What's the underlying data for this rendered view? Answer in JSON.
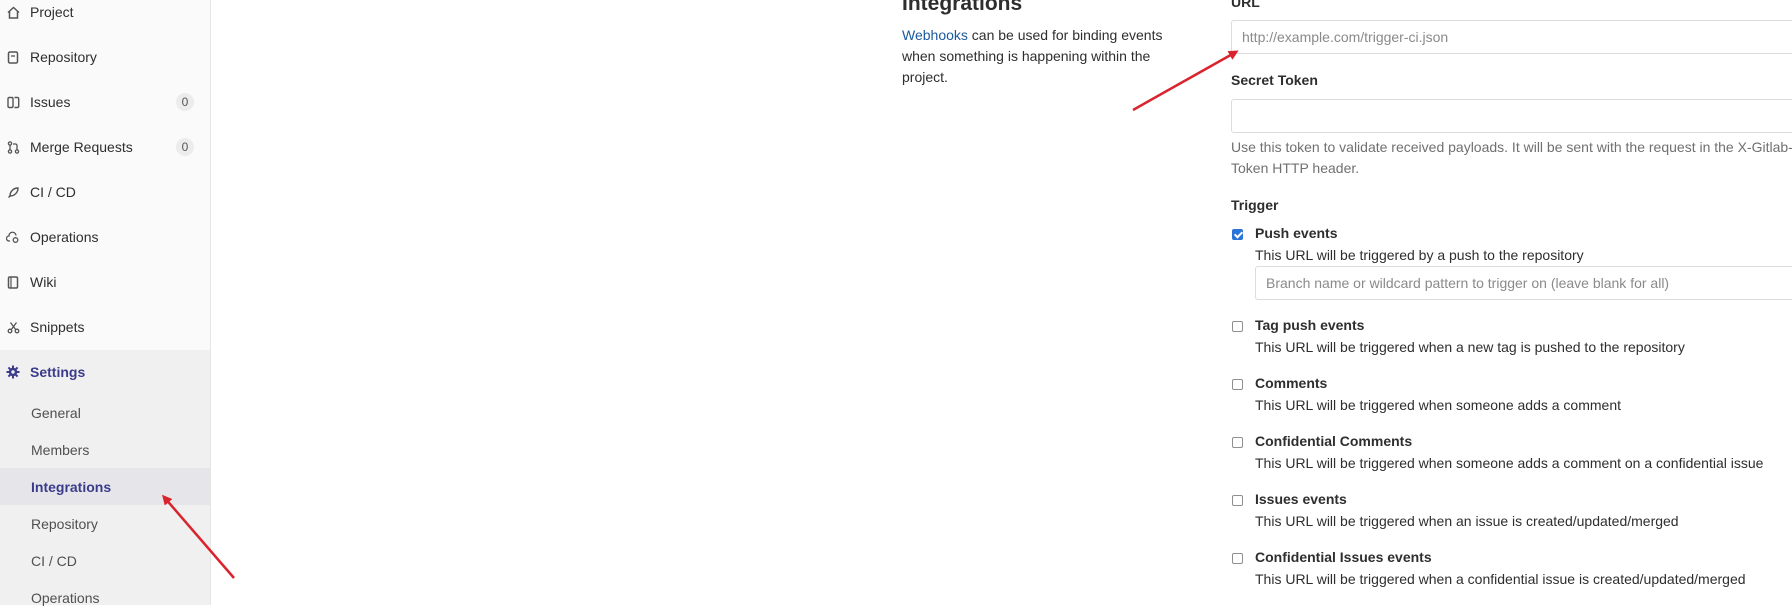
{
  "sidebar": {
    "items": [
      {
        "label": "Project",
        "icon": "home-icon"
      },
      {
        "label": "Repository",
        "icon": "doc-icon"
      },
      {
        "label": "Issues",
        "icon": "issues-icon",
        "badge": "0"
      },
      {
        "label": "Merge Requests",
        "icon": "merge-request-icon",
        "badge": "0"
      },
      {
        "label": "CI / CD",
        "icon": "rocket-icon"
      },
      {
        "label": "Operations",
        "icon": "cloud-gear-icon"
      },
      {
        "label": "Wiki",
        "icon": "book-icon"
      },
      {
        "label": "Snippets",
        "icon": "scissors-icon"
      }
    ],
    "settings": {
      "label": "Settings",
      "icon": "gear-icon",
      "sub_items": [
        "General",
        "Members",
        "Integrations",
        "Repository",
        "CI / CD",
        "Operations"
      ],
      "active": "Integrations"
    }
  },
  "integrations": {
    "title": "Integrations",
    "desc_link": "Webhooks",
    "desc_rest": "can be used for binding events when something is happening within the project."
  },
  "form": {
    "url_label": "URL",
    "url_placeholder": "http://example.com/trigger-ci.json",
    "secret_label": "Secret Token",
    "secret_value": "",
    "secret_help": "Use this token to validate received payloads. It will be sent with the request in the X-Gitlab-Token HTTP header.",
    "trigger_label": "Trigger",
    "branch_placeholder": "Branch name or wildcard pattern to trigger on (leave blank for all)",
    "triggers": [
      {
        "title": "Push events",
        "desc": "This URL will be triggered by a push to the repository",
        "checked": true
      },
      {
        "title": "Tag push events",
        "desc": "This URL will be triggered when a new tag is pushed to the repository",
        "checked": false
      },
      {
        "title": "Comments",
        "desc": "This URL will be triggered when someone adds a comment",
        "checked": false
      },
      {
        "title": "Confidential Comments",
        "desc": "This URL will be triggered when someone adds a comment on a confidential issue",
        "checked": false
      },
      {
        "title": "Issues events",
        "desc": "This URL will be triggered when an issue is created/updated/merged",
        "checked": false
      },
      {
        "title": "Confidential Issues events",
        "desc": "This URL will be triggered when a confidential issue is created/updated/merged",
        "checked": false
      }
    ]
  },
  "colors": {
    "accent": "#3b3b8c",
    "link": "#1b5a9c",
    "annotation_arrow": "#d9232d",
    "checkbox_checked": "#2b73d6"
  }
}
